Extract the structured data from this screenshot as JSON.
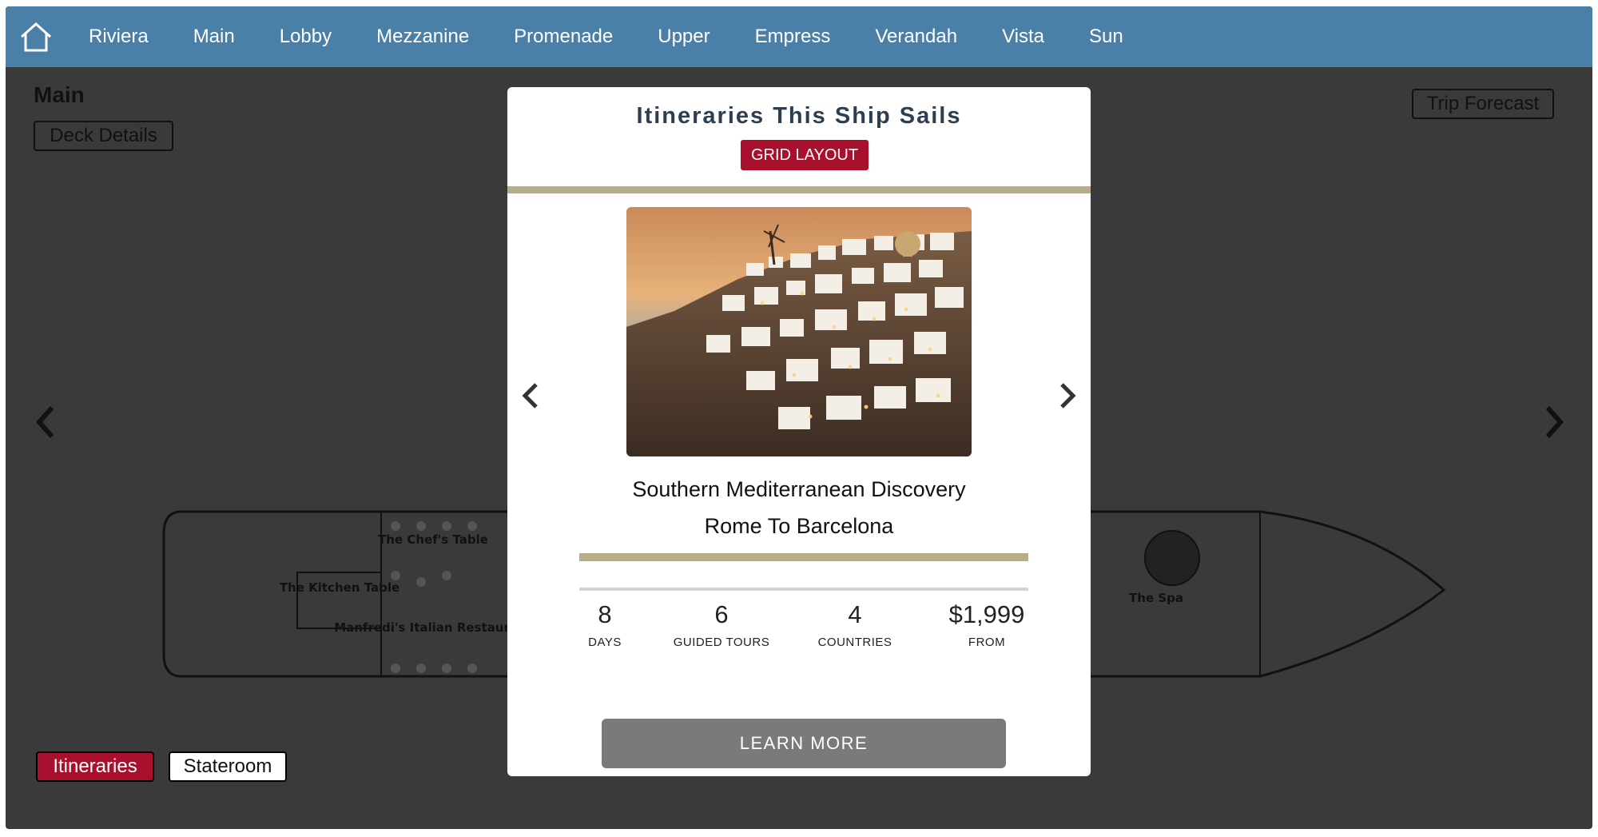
{
  "nav": {
    "items": [
      "Riviera",
      "Main",
      "Lobby",
      "Mezzanine",
      "Promenade",
      "Upper",
      "Empress",
      "Verandah",
      "Vista",
      "Sun"
    ]
  },
  "deck": {
    "title": "Main",
    "details_label": "Deck Details",
    "forecast_label": "Trip Forecast",
    "venues": [
      "The Chef's Table",
      "The Kitchen Table",
      "Manfredi's Italian Restaurant",
      "The Spa"
    ]
  },
  "bottom": {
    "itineraries_label": "Itineraries",
    "stateroom_label": "Stateroom"
  },
  "modal": {
    "title": "Itineraries This Ship Sails",
    "grid_button": "GRID LAYOUT",
    "trip_name": "Southern Mediterranean Discovery",
    "trip_route": "Rome To Barcelona",
    "stats": {
      "days": "8",
      "days_label": "DAYS",
      "tours": "6",
      "tours_label": "GUIDED TOURS",
      "countries": "4",
      "countries_label": "COUNTRIES",
      "price": "$1,999",
      "price_label": "FROM"
    },
    "learn_more": "LEARN MORE"
  },
  "colors": {
    "nav_bg": "#4a7fa7",
    "accent_red": "#a8102e",
    "gold_rule": "#b9ad85",
    "learn_more_bg": "#7a7a7a"
  }
}
